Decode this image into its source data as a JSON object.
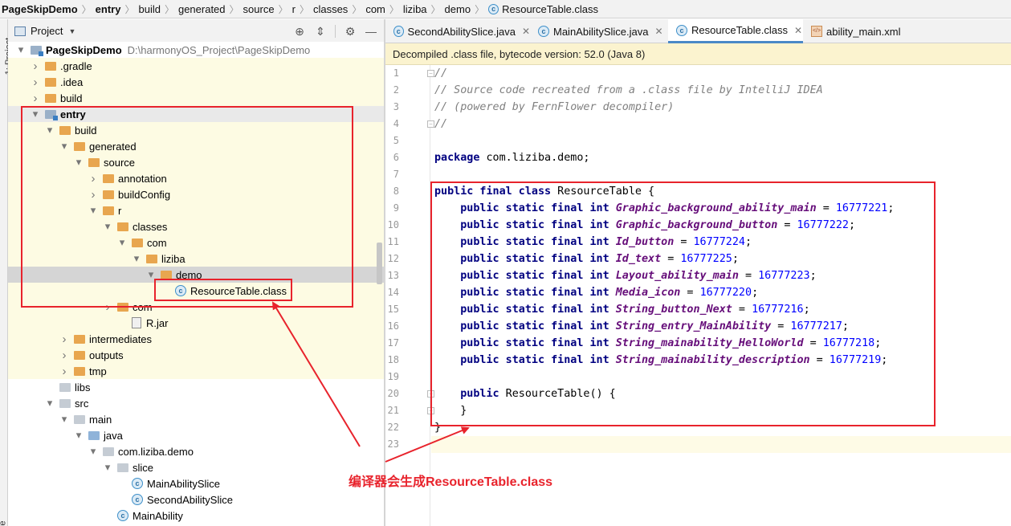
{
  "breadcrumb": [
    {
      "label": "PageSkipDemo",
      "bold": true
    },
    {
      "label": "entry",
      "bold": true
    },
    {
      "label": "build"
    },
    {
      "label": "generated"
    },
    {
      "label": "source"
    },
    {
      "label": "r"
    },
    {
      "label": "classes"
    },
    {
      "label": "com"
    },
    {
      "label": "liziba"
    },
    {
      "label": "demo"
    },
    {
      "label": "ResourceTable.class",
      "icon": "class-icon"
    }
  ],
  "side_strip": {
    "top_label": "1: Project",
    "bottom_label": "ture"
  },
  "project_panel": {
    "title": "Project",
    "icons": [
      "locate-icon",
      "collapse-all-icon",
      "gear-icon",
      "hide-icon"
    ],
    "tree": [
      {
        "label": "PageSkipDemo",
        "detail": "D:\\harmonyOS_Project\\PageSkipDemo",
        "depth": 0,
        "arrow": "down",
        "icon": "module",
        "bold": true
      },
      {
        "label": ".gradle",
        "depth": 1,
        "arrow": "right",
        "icon": "folder",
        "bg": "yellow"
      },
      {
        "label": ".idea",
        "depth": 1,
        "arrow": "right",
        "icon": "folder",
        "bg": "yellow"
      },
      {
        "label": "build",
        "depth": 1,
        "arrow": "right",
        "icon": "folder",
        "bg": "yellow"
      },
      {
        "label": "entry",
        "depth": 1,
        "arrow": "down",
        "icon": "module",
        "bold": true,
        "bg": "sel"
      },
      {
        "label": "build",
        "depth": 2,
        "arrow": "down",
        "icon": "folder",
        "bg": "yellow"
      },
      {
        "label": "generated",
        "depth": 3,
        "arrow": "down",
        "icon": "folder",
        "bg": "yellow"
      },
      {
        "label": "source",
        "depth": 4,
        "arrow": "down",
        "icon": "folder",
        "bg": "yellow"
      },
      {
        "label": "annotation",
        "depth": 5,
        "arrow": "right",
        "icon": "folder",
        "bg": "yellow"
      },
      {
        "label": "buildConfig",
        "depth": 5,
        "arrow": "right",
        "icon": "folder",
        "bg": "yellow"
      },
      {
        "label": "r",
        "depth": 5,
        "arrow": "down",
        "icon": "folder",
        "bg": "yellow"
      },
      {
        "label": "classes",
        "depth": 6,
        "arrow": "down",
        "icon": "folder",
        "bg": "yellow"
      },
      {
        "label": "com",
        "depth": 7,
        "arrow": "down",
        "icon": "folder",
        "bg": "yellow"
      },
      {
        "label": "liziba",
        "depth": 8,
        "arrow": "down",
        "icon": "folder",
        "bg": "yellow"
      },
      {
        "label": "demo",
        "depth": 9,
        "arrow": "down",
        "icon": "folder",
        "bg": "grey"
      },
      {
        "label": "ResourceTable.class",
        "depth": 10,
        "arrow": "",
        "icon": "class",
        "bg": "yellow"
      },
      {
        "label": "com",
        "depth": 6,
        "arrow": "right",
        "icon": "folder",
        "bg": "yellow"
      },
      {
        "label": "R.jar",
        "depth": 7,
        "arrow": "",
        "icon": "jar",
        "bg": "yellow"
      },
      {
        "label": "intermediates",
        "depth": 3,
        "arrow": "right",
        "icon": "folder",
        "bg": "yellow"
      },
      {
        "label": "outputs",
        "depth": 3,
        "arrow": "right",
        "icon": "folder",
        "bg": "yellow"
      },
      {
        "label": "tmp",
        "depth": 3,
        "arrow": "right",
        "icon": "folder",
        "bg": "yellow"
      },
      {
        "label": "libs",
        "depth": 2,
        "arrow": "",
        "icon": "folder-grey",
        "bg": ""
      },
      {
        "label": "src",
        "depth": 2,
        "arrow": "down",
        "icon": "folder-grey",
        "bg": ""
      },
      {
        "label": "main",
        "depth": 3,
        "arrow": "down",
        "icon": "folder-grey",
        "bg": ""
      },
      {
        "label": "java",
        "depth": 4,
        "arrow": "down",
        "icon": "folder-blue",
        "bg": ""
      },
      {
        "label": "com.liziba.demo",
        "depth": 5,
        "arrow": "down",
        "icon": "package",
        "bg": ""
      },
      {
        "label": "slice",
        "depth": 6,
        "arrow": "down",
        "icon": "package",
        "bg": ""
      },
      {
        "label": "MainAbilitySlice",
        "depth": 7,
        "arrow": "",
        "icon": "class",
        "bg": ""
      },
      {
        "label": "SecondAbilitySlice",
        "depth": 7,
        "arrow": "",
        "icon": "class",
        "bg": ""
      },
      {
        "label": "MainAbility",
        "depth": 6,
        "arrow": "",
        "icon": "class",
        "bg": ""
      }
    ]
  },
  "tabs": [
    {
      "label": "SecondAbilitySlice.java",
      "icon": "class",
      "active": false
    },
    {
      "label": "MainAbilitySlice.java",
      "icon": "class",
      "active": false
    },
    {
      "label": "ResourceTable.class",
      "icon": "class",
      "active": true
    },
    {
      "label": "ability_main.xml",
      "icon": "xml",
      "active": false
    }
  ],
  "banner": "Decompiled .class file, bytecode version: 52.0 (Java 8)",
  "code": {
    "line_numbers": [
      "1",
      "2",
      "3",
      "4",
      "5",
      "6",
      "7",
      "8",
      "9",
      "10",
      "11",
      "12",
      "13",
      "14",
      "15",
      "16",
      "17",
      "18",
      "19",
      "20",
      "21",
      "22",
      "23"
    ],
    "comments": [
      "//",
      "// Source code recreated from a .class file by IntelliJ IDEA",
      "// (powered by FernFlower decompiler)",
      "//"
    ],
    "package_kw": "package",
    "package_name": " com.liziba.demo;",
    "class_decl_kw": "public final class",
    "class_name": " ResourceTable {",
    "field_kw": "public static final int",
    "fields": [
      {
        "name": "Graphic_background_ability_main",
        "value": "16777221"
      },
      {
        "name": "Graphic_background_button",
        "value": "16777222"
      },
      {
        "name": "Id_button",
        "value": "16777224"
      },
      {
        "name": "Id_text",
        "value": "16777225"
      },
      {
        "name": "Layout_ability_main",
        "value": "16777223"
      },
      {
        "name": "Media_icon",
        "value": "16777220"
      },
      {
        "name": "String_button_Next",
        "value": "16777216"
      },
      {
        "name": "String_entry_MainAbility",
        "value": "16777217"
      },
      {
        "name": "String_mainability_HelloWorld",
        "value": "16777218"
      },
      {
        "name": "String_mainability_description",
        "value": "16777219"
      }
    ],
    "ctor_kw": "public",
    "ctor_name": " ResourceTable() {",
    "close_brace": "}"
  },
  "annotation": "编译器会生成ResourceTable.class",
  "colors": {
    "annotation_red": "#e8232c",
    "keyword": "#000080",
    "field": "#660e7a",
    "number": "#0000ff",
    "comment": "#808080"
  }
}
